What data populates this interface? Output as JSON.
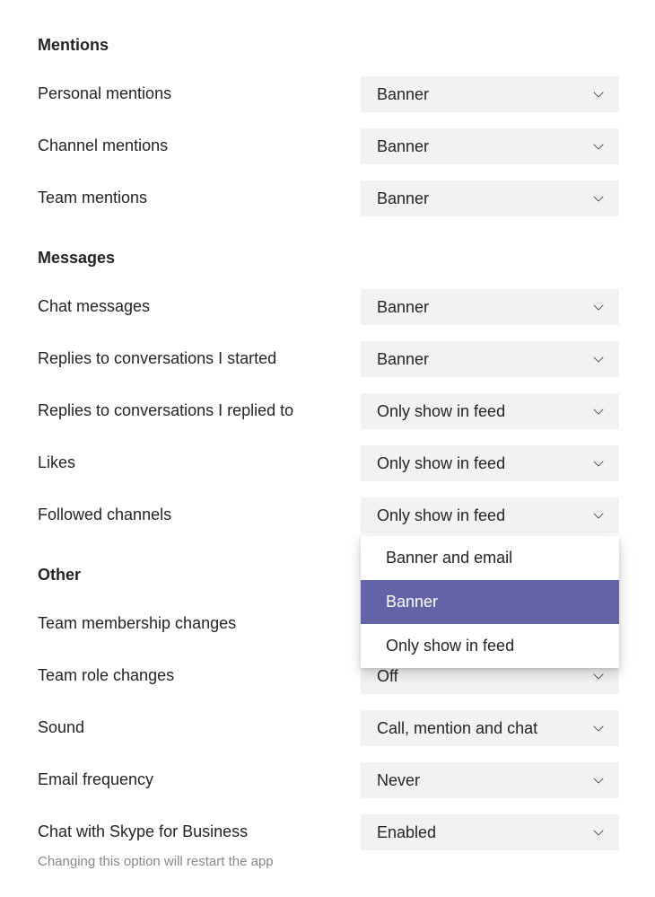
{
  "sections": {
    "mentions": {
      "title": "Mentions",
      "personal_mentions": {
        "label": "Personal mentions",
        "value": "Banner"
      },
      "channel_mentions": {
        "label": "Channel mentions",
        "value": "Banner"
      },
      "team_mentions": {
        "label": "Team mentions",
        "value": "Banner"
      }
    },
    "messages": {
      "title": "Messages",
      "chat_messages": {
        "label": "Chat messages",
        "value": "Banner"
      },
      "replies_started": {
        "label": "Replies to conversations I started",
        "value": "Banner"
      },
      "replies_replied": {
        "label": "Replies to conversations I replied to",
        "value": "Only show in feed"
      },
      "likes": {
        "label": "Likes",
        "value": "Only show in feed"
      },
      "followed_channels": {
        "label": "Followed channels",
        "value": "Only show in feed"
      }
    },
    "other": {
      "title": "Other",
      "team_membership": {
        "label": "Team membership changes",
        "value": ""
      },
      "team_role": {
        "label": "Team role changes",
        "value": "Off"
      },
      "sound": {
        "label": "Sound",
        "value": "Call, mention and chat"
      },
      "email_frequency": {
        "label": "Email frequency",
        "value": "Never"
      },
      "skype_chat": {
        "label": "Chat with Skype for Business",
        "value": "Enabled",
        "subtext": "Changing this option will restart the app"
      }
    }
  },
  "dropdown_open": {
    "options": [
      "Banner and email",
      "Banner",
      "Only show in feed"
    ],
    "selected_index": 1
  }
}
